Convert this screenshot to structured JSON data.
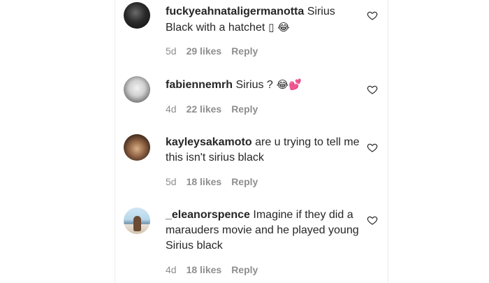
{
  "comments": [
    {
      "username": "fuckyeahnataligermanotta",
      "text": " Sirius Black with a hatchet",
      "trailing": " ▯ 😂",
      "time": "5d",
      "likes": "29 likes",
      "reply": "Reply"
    },
    {
      "username": "fabiennemrh",
      "text": " Sirius ?",
      "trailing": " 😂💕",
      "time": "4d",
      "likes": "22 likes",
      "reply": "Reply"
    },
    {
      "username": "kayleysakamoto",
      "text": " are u trying to tell me this isn't sirius black",
      "trailing": "",
      "time": "5d",
      "likes": "18 likes",
      "reply": "Reply"
    },
    {
      "username": "_eleanorspence",
      "text": " Imagine if they did a marauders movie and he played young Sirius black",
      "trailing": "",
      "time": "4d",
      "likes": "18 likes",
      "reply": "Reply"
    }
  ],
  "icons": {
    "like": "heart-outline-icon"
  },
  "colors": {
    "text": "#262626",
    "meta": "#8e8e8e"
  }
}
